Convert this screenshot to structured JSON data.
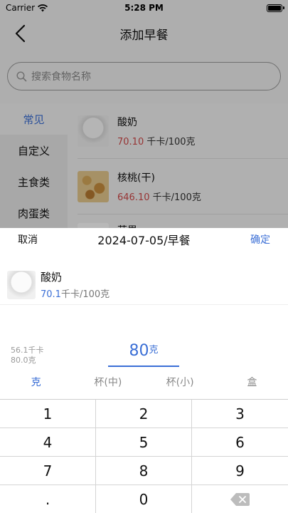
{
  "status": {
    "carrier": "Carrier",
    "time": "5:28 PM"
  },
  "nav": {
    "title": "添加早餐"
  },
  "search": {
    "placeholder": "搜索食物名称"
  },
  "sidebar": {
    "items": [
      {
        "label": "常见",
        "active": true
      },
      {
        "label": "自定义",
        "active": false
      },
      {
        "label": "主食类",
        "active": false
      },
      {
        "label": "肉蛋类",
        "active": false
      }
    ]
  },
  "foods": [
    {
      "name": "酸奶",
      "calories": "70.10",
      "unit": "千卡/100克",
      "icon": "yogurt-icon"
    },
    {
      "name": "核桃(干)",
      "calories": "646.10",
      "unit": "千卡/100克",
      "icon": "walnut-icon"
    },
    {
      "name": "苹果",
      "calories": "",
      "unit": "",
      "icon": "apple-icon"
    }
  ],
  "sheet": {
    "cancel": "取消",
    "title": "2024-07-05/早餐",
    "confirm": "确定",
    "food_name": "酸奶",
    "food_cal": "70.1",
    "food_unit": "千卡/100克",
    "summary_cal": "56.1千卡",
    "summary_weight": "80.0克",
    "amount": "80",
    "amount_unit": "克",
    "units": [
      {
        "label": "克",
        "active": true
      },
      {
        "label": "杯(中)",
        "active": false
      },
      {
        "label": "杯(小)",
        "active": false
      },
      {
        "label": "盒",
        "active": false
      }
    ]
  },
  "keypad": {
    "keys": [
      "1",
      "2",
      "3",
      "4",
      "5",
      "6",
      "7",
      "8",
      "9",
      ".",
      "0"
    ]
  },
  "colors": {
    "accent": "#3b6fd6",
    "calorie_red": "#d24a4a"
  }
}
